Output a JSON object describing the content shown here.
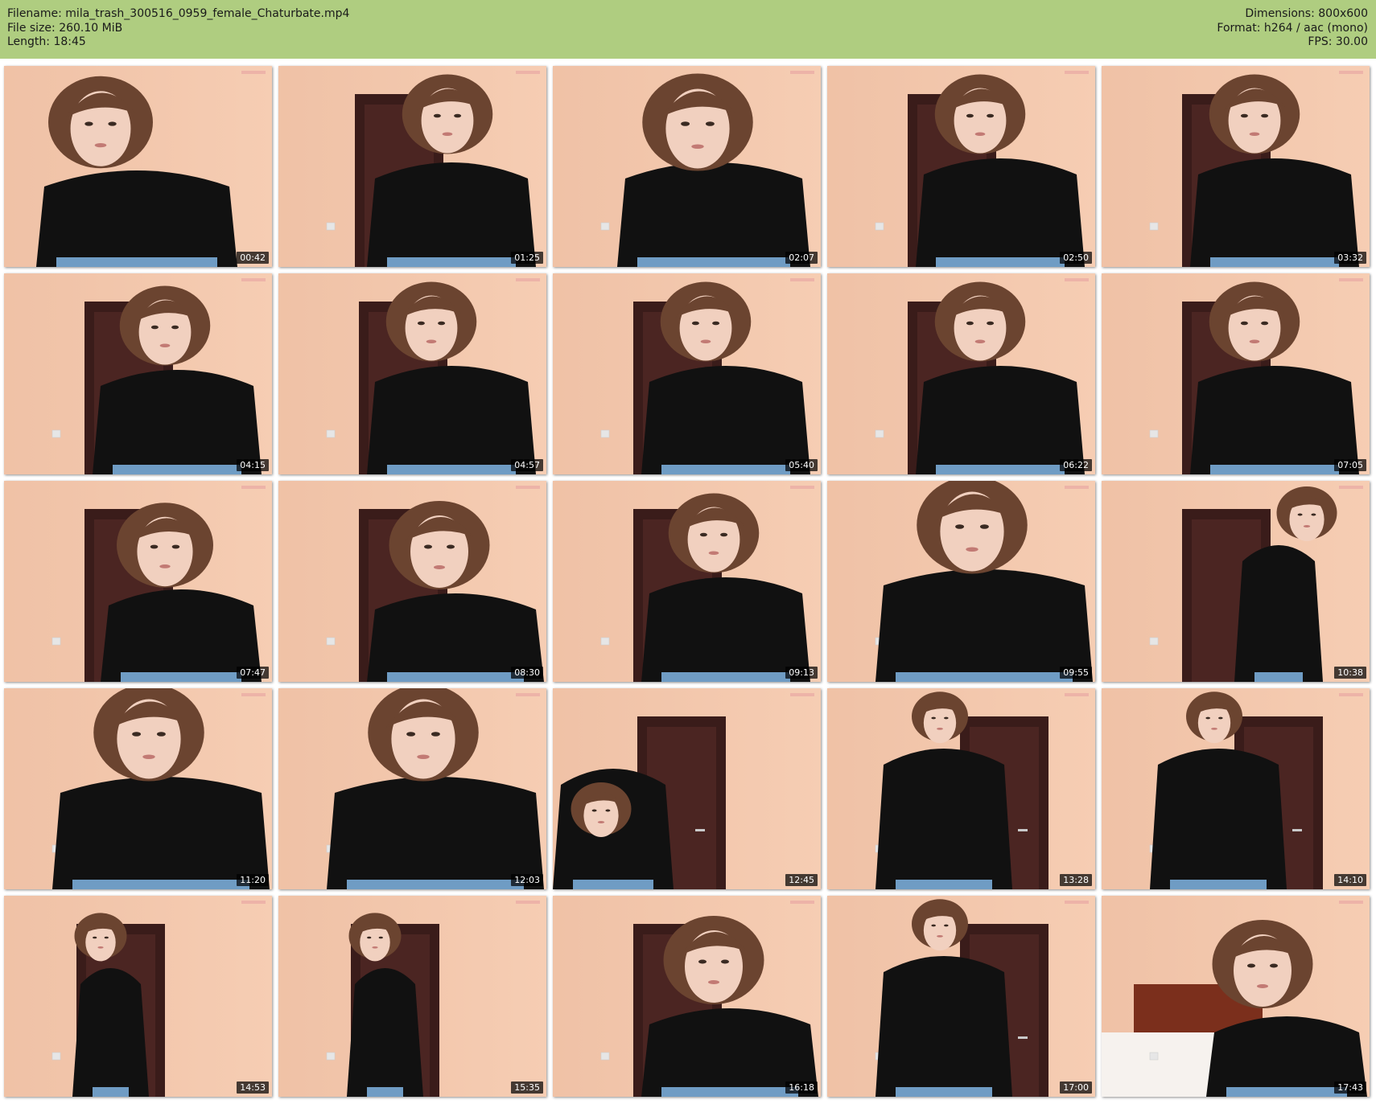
{
  "header": {
    "filename_label": "Filename: mila_trash_300516_0959_female_Chaturbate.mp4",
    "filesize_label": "File size: 260.10 MiB",
    "length_label": "Length: 18:45",
    "dimensions_label": "Dimensions: 800x600",
    "format_label": "Format: h264 / aac (mono)",
    "fps_label": "FPS: 30.00"
  },
  "colors": {
    "header_bg": "#afcd80",
    "wall": "#f3c7ab",
    "door": "#3a1c1a",
    "sweater": "#111111",
    "hair": "#6b4430",
    "jeans": "#6f9cc4"
  },
  "thumbnails": [
    {
      "time": "00:42",
      "scene": "lean-left-hair"
    },
    {
      "time": "01:25",
      "scene": "lean-right"
    },
    {
      "time": "02:07",
      "scene": "head-down"
    },
    {
      "time": "02:50",
      "scene": "center"
    },
    {
      "time": "03:32",
      "scene": "center-smile"
    },
    {
      "time": "04:15",
      "scene": "tilt"
    },
    {
      "time": "04:57",
      "scene": "center"
    },
    {
      "time": "05:40",
      "scene": "center"
    },
    {
      "time": "06:22",
      "scene": "center"
    },
    {
      "time": "07:05",
      "scene": "center"
    },
    {
      "time": "07:47",
      "scene": "hand-mouth"
    },
    {
      "time": "08:30",
      "scene": "lean"
    },
    {
      "time": "09:13",
      "scene": "tilt"
    },
    {
      "time": "09:55",
      "scene": "close"
    },
    {
      "time": "10:38",
      "scene": "side"
    },
    {
      "time": "11:20",
      "scene": "close"
    },
    {
      "time": "12:03",
      "scene": "close"
    },
    {
      "time": "12:45",
      "scene": "bend"
    },
    {
      "time": "13:28",
      "scene": "standing"
    },
    {
      "time": "14:10",
      "scene": "standing"
    },
    {
      "time": "14:53",
      "scene": "standing-far"
    },
    {
      "time": "15:35",
      "scene": "standing-far"
    },
    {
      "time": "16:18",
      "scene": "lean"
    },
    {
      "time": "17:00",
      "scene": "standing"
    },
    {
      "time": "17:43",
      "scene": "bedroom"
    }
  ]
}
